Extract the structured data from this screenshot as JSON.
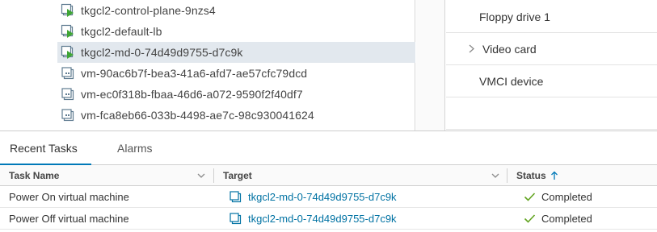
{
  "inventory_tree": {
    "items": [
      {
        "label": "tkgcl2-control-plane-9nzs4",
        "icon": "vm-powered-on-icon",
        "selected": false
      },
      {
        "label": "tkgcl2-default-lb",
        "icon": "vm-powered-on-icon",
        "selected": false
      },
      {
        "label": "tkgcl2-md-0-74d49d9755-d7c9k",
        "icon": "vm-powered-on-icon",
        "selected": true
      },
      {
        "label": "vm-90ac6b7f-bea3-41a6-afd7-ae57cfc79dcd",
        "icon": "vm-icon",
        "selected": false
      },
      {
        "label": "vm-ec0f318b-fbaa-46d6-a072-9590f2f40df7",
        "icon": "vm-icon",
        "selected": false
      },
      {
        "label": "vm-fca8eb66-033b-4498-ae7c-98c930041624",
        "icon": "vm-icon",
        "selected": false
      }
    ]
  },
  "hardware": {
    "rows": [
      {
        "label": "Floppy drive 1",
        "expandable": false
      },
      {
        "label": "Video card",
        "expandable": true
      },
      {
        "label": "VMCI device",
        "expandable": false
      }
    ]
  },
  "bottom_panel": {
    "tabs": [
      {
        "label": "Recent Tasks",
        "active": true
      },
      {
        "label": "Alarms",
        "active": false
      }
    ],
    "columns": {
      "task_name": "Task Name",
      "target": "Target",
      "status": "Status"
    },
    "sort": {
      "column": "status",
      "direction": "ascending",
      "icon": "arrow-up-icon"
    },
    "rows": [
      {
        "task_name": "Power On virtual machine",
        "target": "tkgcl2-md-0-74d49d9755-d7c9k",
        "status": "Completed"
      },
      {
        "task_name": "Power Off virtual machine",
        "target": "tkgcl2-md-0-74d49d9755-d7c9k",
        "status": "Completed"
      }
    ]
  },
  "colors": {
    "accent": "#0079b8",
    "link": "#0072a3",
    "success": "#62a420",
    "power_on": "#3fa535",
    "selection": "#e2e8ee"
  }
}
